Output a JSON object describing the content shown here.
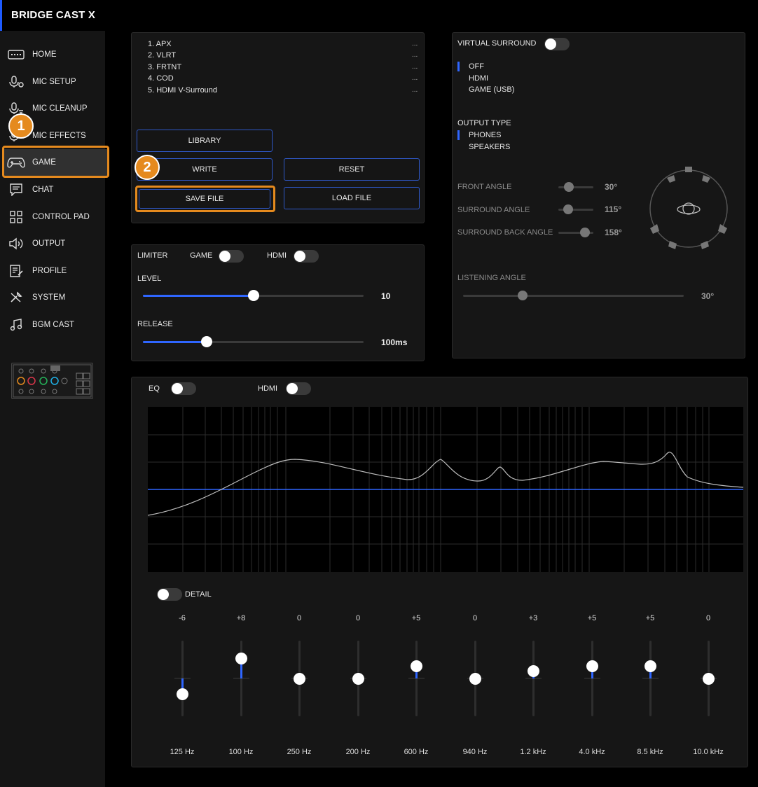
{
  "app": {
    "title": "BRIDGE CAST X"
  },
  "sidebar": {
    "items": [
      {
        "label": "HOME",
        "icon": "keyboard-icon"
      },
      {
        "label": "MIC SETUP",
        "icon": "mic-settings-icon"
      },
      {
        "label": "MIC CLEANUP",
        "icon": "mic-cleanup-icon"
      },
      {
        "label": "MIC EFFECTS",
        "icon": "mic-effects-icon"
      },
      {
        "label": "GAME",
        "icon": "gamepad-icon",
        "active": true
      },
      {
        "label": "CHAT",
        "icon": "chat-icon"
      },
      {
        "label": "CONTROL PAD",
        "icon": "grid-icon"
      },
      {
        "label": "OUTPUT",
        "icon": "speaker-icon"
      },
      {
        "label": "PROFILE",
        "icon": "profile-icon"
      },
      {
        "label": "SYSTEM",
        "icon": "wrench-icon"
      },
      {
        "label": "BGM CAST",
        "icon": "music-icon"
      }
    ]
  },
  "callouts": {
    "one": "1",
    "two": "2"
  },
  "library": {
    "items": [
      "1. APX",
      "2. VLRT",
      "3. FRTNT",
      "4. COD",
      "5. HDMI V-Surround"
    ],
    "dots": "...",
    "buttons": {
      "library": "LIBRARY",
      "write": "WRITE",
      "reset": "RESET",
      "save": "SAVE FILE",
      "load": "LOAD FILE"
    }
  },
  "limiter": {
    "label": "LIMITER",
    "game_label": "GAME",
    "hdmi_label": "HDMI",
    "level_label": "LEVEL",
    "level_value": "10",
    "level_fraction": 0.5,
    "release_label": "RELEASE",
    "release_value": "100ms",
    "release_fraction": 0.29
  },
  "surround": {
    "label": "VIRTUAL SURROUND",
    "options": [
      "OFF",
      "HDMI",
      "GAME (USB)"
    ],
    "selected_option": "OFF",
    "output_type_label": "OUTPUT TYPE",
    "output_types": [
      "PHONES",
      "SPEAKERS"
    ],
    "selected_output": "PHONES",
    "front_angle_label": "FRONT ANGLE",
    "front_angle_value": "30°",
    "front_angle_fraction": 0.3,
    "surround_angle_label": "SURROUND ANGLE",
    "surround_angle_value": "115°",
    "surround_angle_fraction": 0.28,
    "surround_back_angle_label": "SURROUND BACK ANGLE",
    "surround_back_angle_value": "158°",
    "surround_back_angle_fraction": 0.75,
    "listening_angle_label": "LISTENING ANGLE",
    "listening_angle_value": "30°",
    "listening_angle_fraction": 0.27
  },
  "eq": {
    "label": "EQ",
    "hdmi_label": "HDMI",
    "detail_label": "DETAIL",
    "bands": [
      {
        "gain": "-6",
        "freq": "125 Hz",
        "level": -6
      },
      {
        "gain": "+8",
        "freq": "100 Hz",
        "level": 8
      },
      {
        "gain": "0",
        "freq": "250 Hz",
        "level": 0
      },
      {
        "gain": "0",
        "freq": "200 Hz",
        "level": 0
      },
      {
        "gain": "+5",
        "freq": "600 Hz",
        "level": 5
      },
      {
        "gain": "0",
        "freq": "940 Hz",
        "level": 0
      },
      {
        "gain": "+3",
        "freq": "1.2 kHz",
        "level": 3
      },
      {
        "gain": "+5",
        "freq": "4.0 kHz",
        "level": 5
      },
      {
        "gain": "+5",
        "freq": "8.5 kHz",
        "level": 5
      },
      {
        "gain": "0",
        "freq": "10.0 kHz",
        "level": 0
      }
    ]
  },
  "colors": {
    "accent": "#2f66ff",
    "highlight": "#e58a1e",
    "panel": "#161616"
  }
}
